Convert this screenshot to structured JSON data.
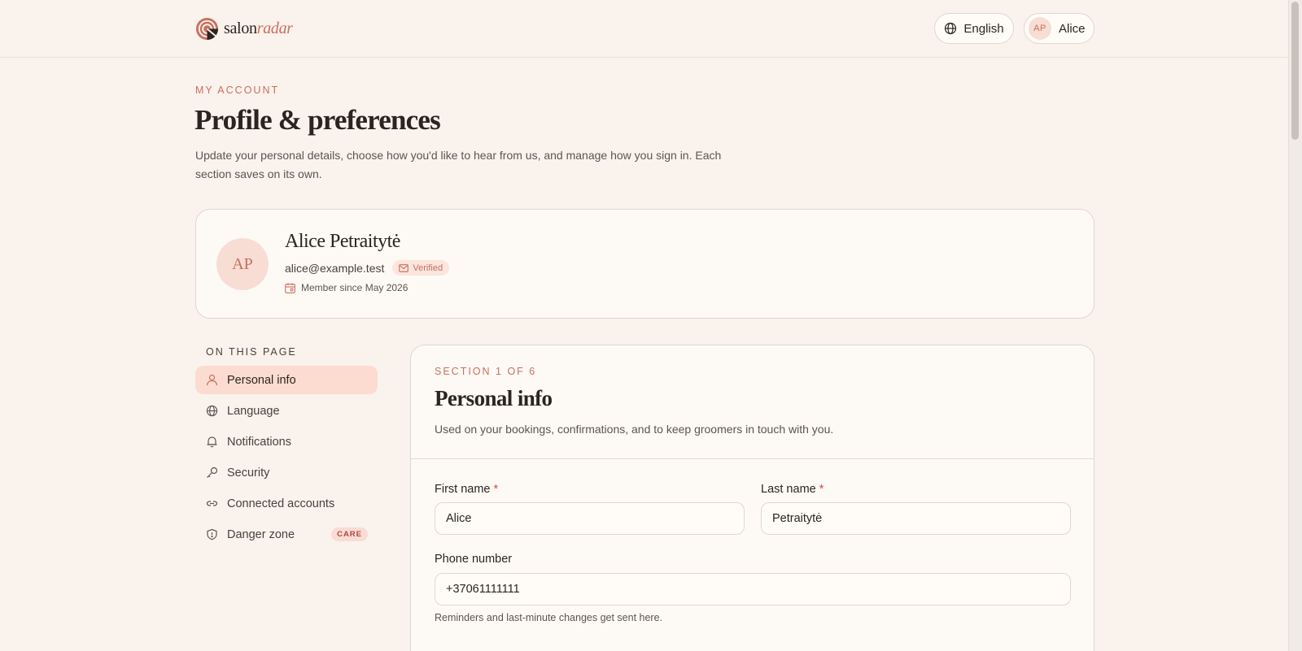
{
  "brand": {
    "name_part1": "salon",
    "name_part2": "radar"
  },
  "header": {
    "language_label": "English",
    "user_initials": "AP",
    "user_name": "Alice"
  },
  "page": {
    "eyebrow": "MY ACCOUNT",
    "title": "Profile & preferences",
    "description": "Update your personal details, choose how you'd like to hear from us, and manage how you sign in. Each section saves on its own."
  },
  "profile": {
    "initials": "AP",
    "name": "Alice Petraitytė",
    "email": "alice@example.test",
    "verified_label": "Verified",
    "member_since": "Member since May 2026"
  },
  "toc": {
    "title": "ON THIS PAGE",
    "items": [
      {
        "label": "Personal info",
        "icon": "user-icon"
      },
      {
        "label": "Language",
        "icon": "globe-icon"
      },
      {
        "label": "Notifications",
        "icon": "bell-icon"
      },
      {
        "label": "Security",
        "icon": "key-icon"
      },
      {
        "label": "Connected accounts",
        "icon": "link-icon"
      },
      {
        "label": "Danger zone",
        "icon": "shield-icon",
        "badge": "CARE"
      }
    ]
  },
  "section": {
    "eyebrow": "SECTION 1 OF 6",
    "title": "Personal info",
    "description": "Used on your bookings, confirmations, and to keep groomers in touch with you.",
    "fields": {
      "first_name": {
        "label": "First name",
        "required_mark": "*",
        "value": "Alice"
      },
      "last_name": {
        "label": "Last name",
        "required_mark": "*",
        "value": "Petraitytė"
      },
      "phone": {
        "label": "Phone number",
        "value": "+37061111111",
        "help": "Reminders and last-minute changes get sent here."
      }
    }
  },
  "colors": {
    "accent": "#c8705f",
    "background": "#faf2ec",
    "active_nav": "#fcdcd0"
  }
}
